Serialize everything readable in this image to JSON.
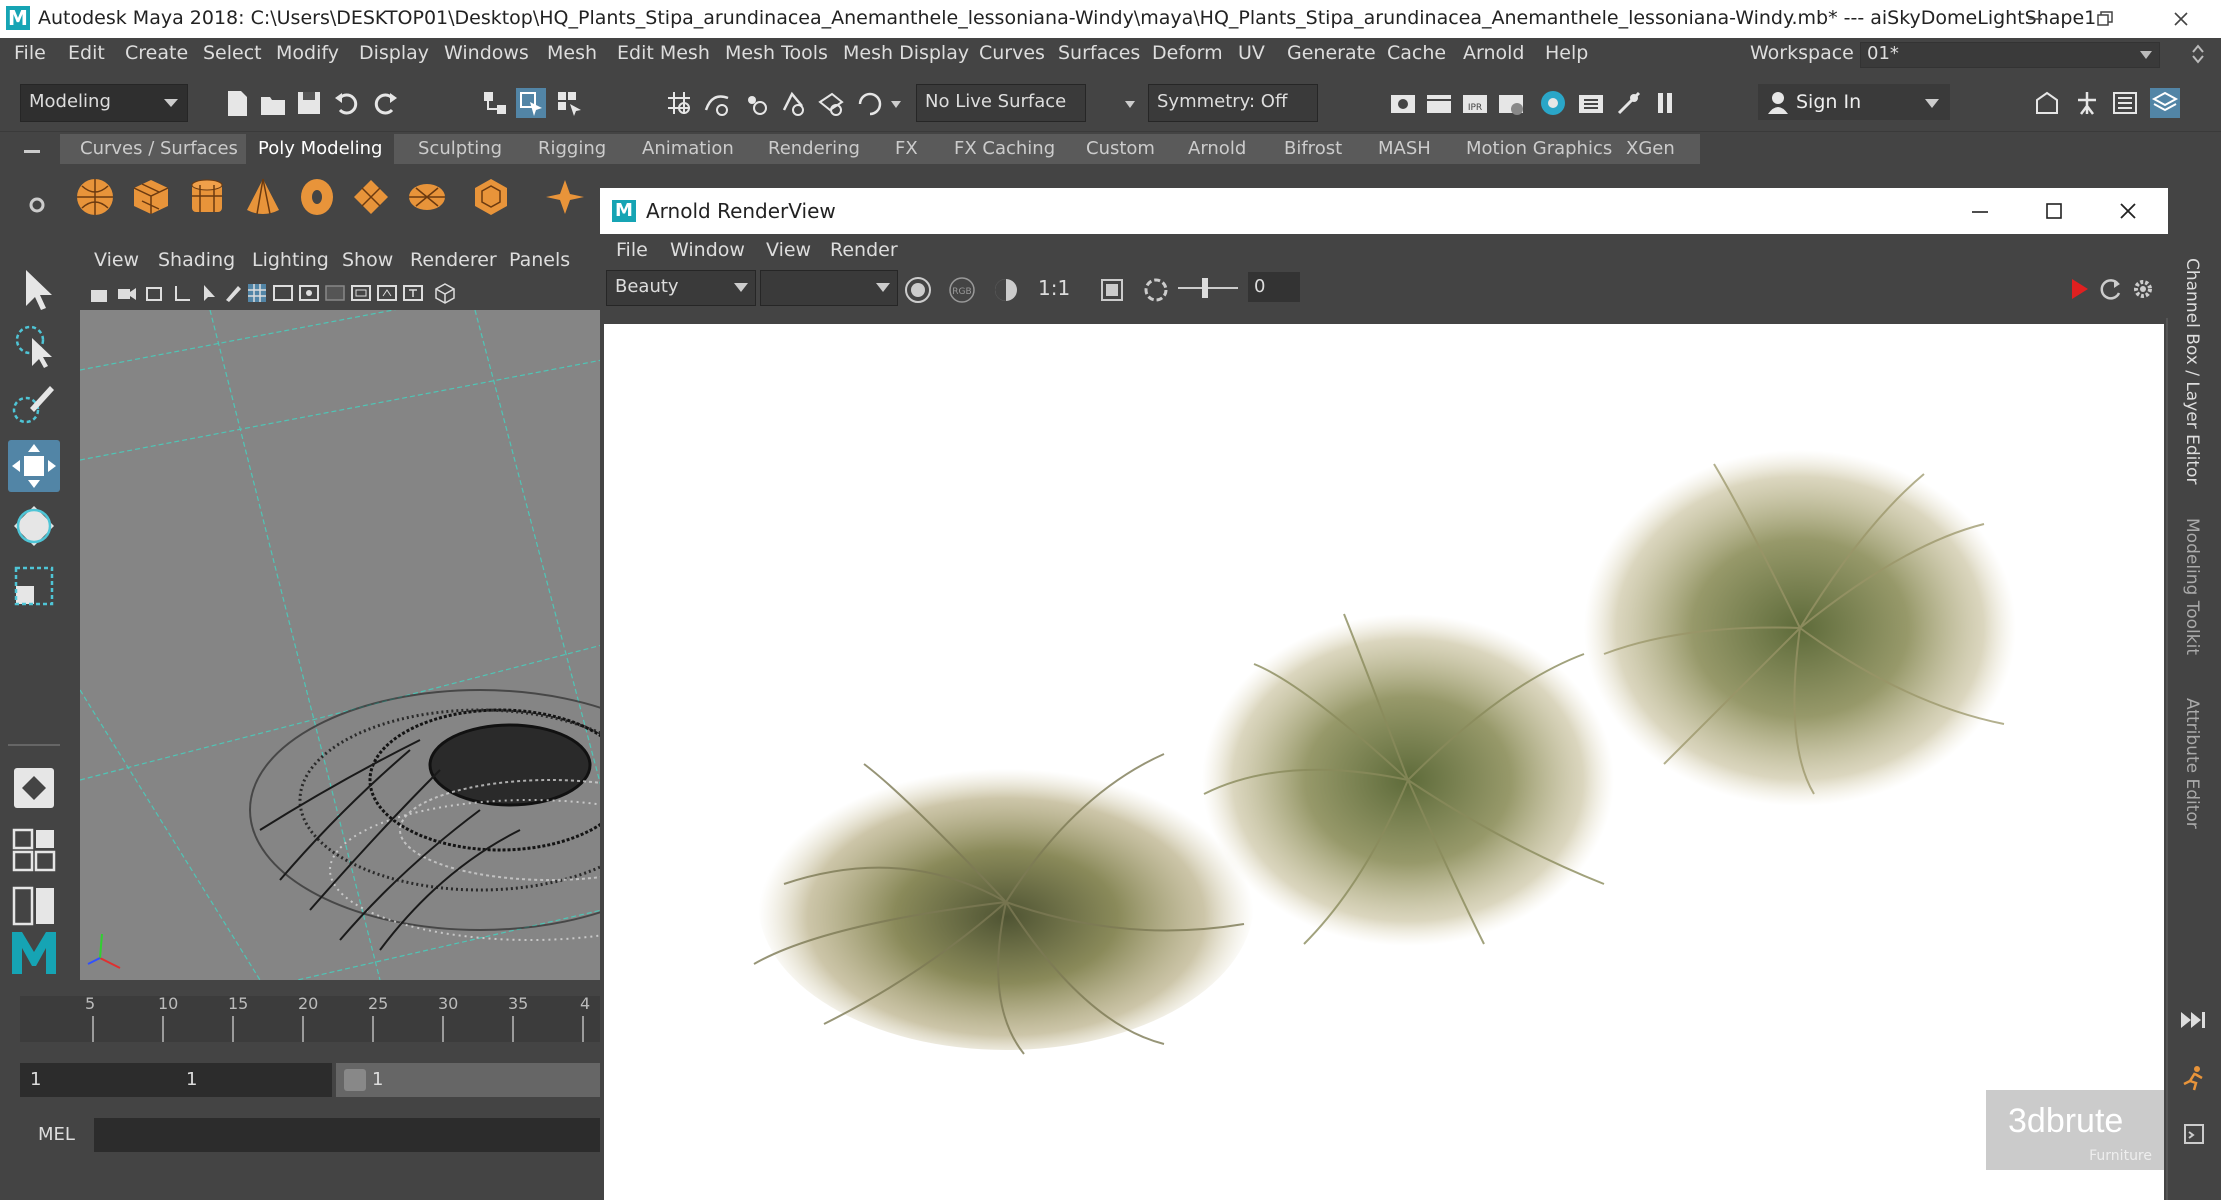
{
  "titlebar": {
    "title": "Autodesk Maya 2018: C:\\Users\\DESKTOP01\\Desktop\\HQ_Plants_Stipa_arundinacea_Anemanthele_lessoniana-Windy\\maya\\HQ_Plants_Stipa_arundinacea_Anemanthele_lessoniana-Windy.mb*  ---  aiSkyDomeLightShape1"
  },
  "menubar": {
    "items": [
      "File",
      "Edit",
      "Create",
      "Select",
      "Modify",
      "Display",
      "Windows",
      "Mesh",
      "Edit Mesh",
      "Mesh Tools",
      "Mesh Display",
      "Curves",
      "Surfaces",
      "Deform",
      "UV",
      "Generate",
      "Cache",
      "Arnold",
      "Help"
    ],
    "workspace_label": "Workspace :",
    "workspace_value": "01*"
  },
  "statusline": {
    "menuset": "Modeling",
    "live_surface": "No Live Surface",
    "symmetry": "Symmetry: Off",
    "sign_in": "Sign In"
  },
  "shelf": {
    "tabs": [
      "Curves / Surfaces",
      "Poly Modeling",
      "Sculpting",
      "Rigging",
      "Animation",
      "Rendering",
      "FX",
      "FX Caching",
      "Custom",
      "Arnold",
      "Bifrost",
      "MASH",
      "Motion Graphics",
      "XGen"
    ],
    "active_tab": "Poly Modeling"
  },
  "viewport": {
    "menu": [
      "View",
      "Shading",
      "Lighting",
      "Show",
      "Renderer",
      "Panels"
    ]
  },
  "timeslider": {
    "ticks": [
      "5",
      "10",
      "15",
      "20",
      "25",
      "30",
      "35",
      "4"
    ]
  },
  "range": {
    "start": "1",
    "current": "1",
    "anim_start": "1"
  },
  "command_line": {
    "label": "MEL"
  },
  "renderview": {
    "title": "Arnold RenderView",
    "menu": [
      "File",
      "Window",
      "View",
      "Render"
    ],
    "aov": "Beauty",
    "camera": "",
    "ratio": "1:1",
    "exposure": "0"
  },
  "rightbar": {
    "tabs": [
      "Channel Box / Layer Editor",
      "Modeling Toolkit",
      "Attribute Editor"
    ]
  },
  "watermark": {
    "brand": "3dbrute",
    "sub": "Furniture"
  },
  "colors": {
    "maya_orange": "#e8943a",
    "teal_grid": "#4fc5b6",
    "accent_blue": "#5285a6",
    "render_red": "#e02020"
  }
}
